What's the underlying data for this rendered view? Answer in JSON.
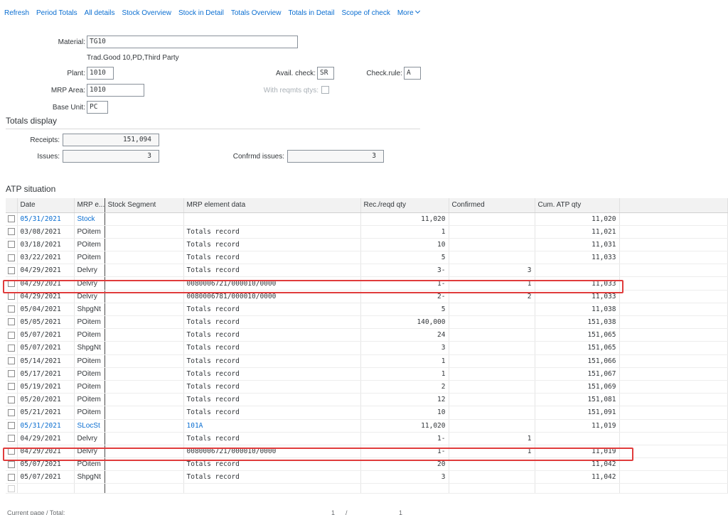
{
  "toolbar": {
    "items": [
      "Refresh",
      "Period Totals",
      "All details",
      "Stock Overview",
      "Stock in Detail",
      "Totals Overview",
      "Totals in Detail",
      "Scope of check",
      "More"
    ]
  },
  "header": {
    "material_label": "Material:",
    "material_value": "TG10",
    "material_desc": "Trad.Good 10,PD,Third Party",
    "plant_label": "Plant:",
    "plant_value": "1010",
    "avail_check_label": "Avail. check:",
    "avail_check_value": "SR",
    "check_rule_label": "Check.rule:",
    "check_rule_value": "A",
    "mrp_area_label": "MRP Area:",
    "mrp_area_value": "1010",
    "with_reqmts_label": "With reqmts qtys:",
    "base_unit_label": "Base Unit:",
    "base_unit_value": "PC"
  },
  "totals": {
    "title": "Totals display",
    "receipts_label": "Receipts:",
    "receipts_value": "151,094",
    "issues_label": "Issues:",
    "issues_value": "3",
    "confirmed_issues_label": "Confrmd issues:",
    "confirmed_issues_value": "3"
  },
  "atp": {
    "title": "ATP situation",
    "columns": [
      "Date",
      "MRP e...",
      "Stock Segment",
      "MRP element data",
      "Rec./reqd qty",
      "Confirmed",
      "Cum. ATP qty"
    ],
    "rows": [
      {
        "date": "05/31/2021",
        "elem": "Stock",
        "seg": "",
        "data": "",
        "qty": "11,020",
        "conf": "",
        "cum": "11,020",
        "link": true
      },
      {
        "date": "03/08/2021",
        "elem": "POitem",
        "seg": "",
        "data": "Totals record",
        "qty": "1",
        "conf": "",
        "cum": "11,021",
        "link": false
      },
      {
        "date": "03/18/2021",
        "elem": "POitem",
        "seg": "",
        "data": "Totals record",
        "qty": "10",
        "conf": "",
        "cum": "11,031",
        "link": false
      },
      {
        "date": "03/22/2021",
        "elem": "POitem",
        "seg": "",
        "data": "Totals record",
        "qty": "5",
        "conf": "",
        "cum": "11,033",
        "link": false
      },
      {
        "date": "04/29/2021",
        "elem": "Delvry",
        "seg": "",
        "data": "Totals record",
        "qty": "3-",
        "conf": "3",
        "cum": "",
        "link": false
      },
      {
        "date": "04/29/2021",
        "elem": "Delvry",
        "seg": "",
        "data": "0080006721/000010/0000",
        "qty": "1-",
        "conf": "1",
        "cum": "11,033",
        "link": false
      },
      {
        "date": "04/29/2021",
        "elem": "Delvry",
        "seg": "",
        "data": "0080006781/000010/0000",
        "qty": "2-",
        "conf": "2",
        "cum": "11,033",
        "link": false
      },
      {
        "date": "05/04/2021",
        "elem": "ShpgNt",
        "seg": "",
        "data": "Totals record",
        "qty": "5",
        "conf": "",
        "cum": "11,038",
        "link": false
      },
      {
        "date": "05/05/2021",
        "elem": "POitem",
        "seg": "",
        "data": "Totals record",
        "qty": "140,000",
        "conf": "",
        "cum": "151,038",
        "link": false
      },
      {
        "date": "05/07/2021",
        "elem": "POitem",
        "seg": "",
        "data": "Totals record",
        "qty": "24",
        "conf": "",
        "cum": "151,065",
        "link": false
      },
      {
        "date": "05/07/2021",
        "elem": "ShpgNt",
        "seg": "",
        "data": "Totals record",
        "qty": "3",
        "conf": "",
        "cum": "151,065",
        "link": false
      },
      {
        "date": "05/14/2021",
        "elem": "POitem",
        "seg": "",
        "data": "Totals record",
        "qty": "1",
        "conf": "",
        "cum": "151,066",
        "link": false
      },
      {
        "date": "05/17/2021",
        "elem": "POitem",
        "seg": "",
        "data": "Totals record",
        "qty": "1",
        "conf": "",
        "cum": "151,067",
        "link": false
      },
      {
        "date": "05/19/2021",
        "elem": "POitem",
        "seg": "",
        "data": "Totals record",
        "qty": "2",
        "conf": "",
        "cum": "151,069",
        "link": false
      },
      {
        "date": "05/20/2021",
        "elem": "POitem",
        "seg": "",
        "data": "Totals record",
        "qty": "12",
        "conf": "",
        "cum": "151,081",
        "link": false
      },
      {
        "date": "05/21/2021",
        "elem": "POitem",
        "seg": "",
        "data": "Totals record",
        "qty": "10",
        "conf": "",
        "cum": "151,091",
        "link": false
      },
      {
        "date": "05/31/2021",
        "elem": "SLocSt",
        "seg": "",
        "data": "101A",
        "qty": "11,020",
        "conf": "",
        "cum": "11,019",
        "link": true
      },
      {
        "date": "04/29/2021",
        "elem": "Delvry",
        "seg": "",
        "data": "Totals record",
        "qty": "1-",
        "conf": "1",
        "cum": "",
        "link": false
      },
      {
        "date": "04/29/2021",
        "elem": "Delvry",
        "seg": "",
        "data": "0080006721/000010/0000",
        "qty": "1-",
        "conf": "1",
        "cum": "11,019",
        "link": false
      },
      {
        "date": "05/07/2021",
        "elem": "POitem",
        "seg": "",
        "data": "Totals record",
        "qty": "20",
        "conf": "",
        "cum": "11,042",
        "link": false
      },
      {
        "date": "05/07/2021",
        "elem": "ShpgNt",
        "seg": "",
        "data": "Totals record",
        "qty": "3",
        "conf": "",
        "cum": "11,042",
        "link": false
      }
    ]
  },
  "footer": {
    "page_label": "Current page / Total:",
    "page_current": "1",
    "page_sep": "/",
    "page_total": "1"
  },
  "colors": {
    "link": "#0a6ed1",
    "highlight": "#e03c3c"
  }
}
